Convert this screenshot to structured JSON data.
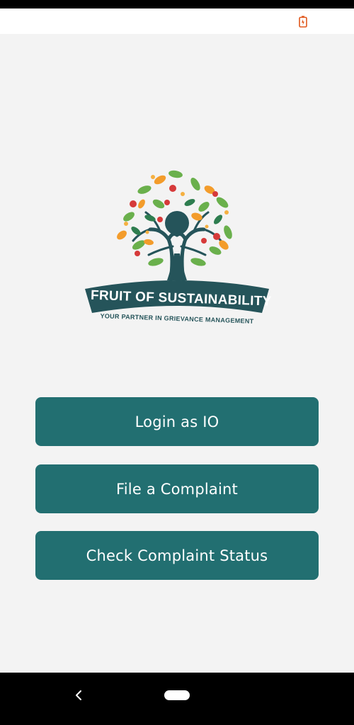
{
  "colors": {
    "accent": "#226f71",
    "button_text": "#ffffff",
    "battery_icon": "#e0561b",
    "background": "#f3f3f3"
  },
  "status_bar": {
    "battery_icon": "battery-charging-icon"
  },
  "logo": {
    "title": "FRUIT OF SUSTAINABILITY",
    "tagline": "YOUR PARTNER IN GRIEVANCE MANAGEMENT"
  },
  "buttons": {
    "login_label": "Login as IO",
    "file_label": "File a Complaint",
    "status_label": "Check Complaint Status"
  },
  "nav": {
    "back_icon": "back-chevron-icon",
    "home_icon": "home-pill-icon"
  }
}
